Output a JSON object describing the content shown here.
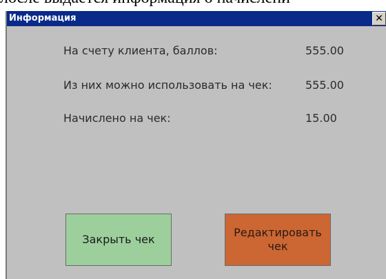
{
  "background_line": "лосле выдается информация о начислени",
  "dialog": {
    "title": "Информация",
    "close_symbol": "✕",
    "rows": [
      {
        "label": "На счету клиента, баллов:",
        "value": "555.00"
      },
      {
        "label": "Из них можно использовать на чек:",
        "value": "555.00"
      },
      {
        "label": "Начислено на чек:",
        "value": "15.00"
      }
    ],
    "buttons": {
      "close_receipt": "Закрыть чек",
      "edit_receipt": "Редактировать чек"
    },
    "colors": {
      "titlebar": "#0a2a8a",
      "dialog_bg": "#c0c0c0",
      "close_receipt_button": "#9ccf9c",
      "edit_receipt_button": "#cc6633"
    }
  }
}
